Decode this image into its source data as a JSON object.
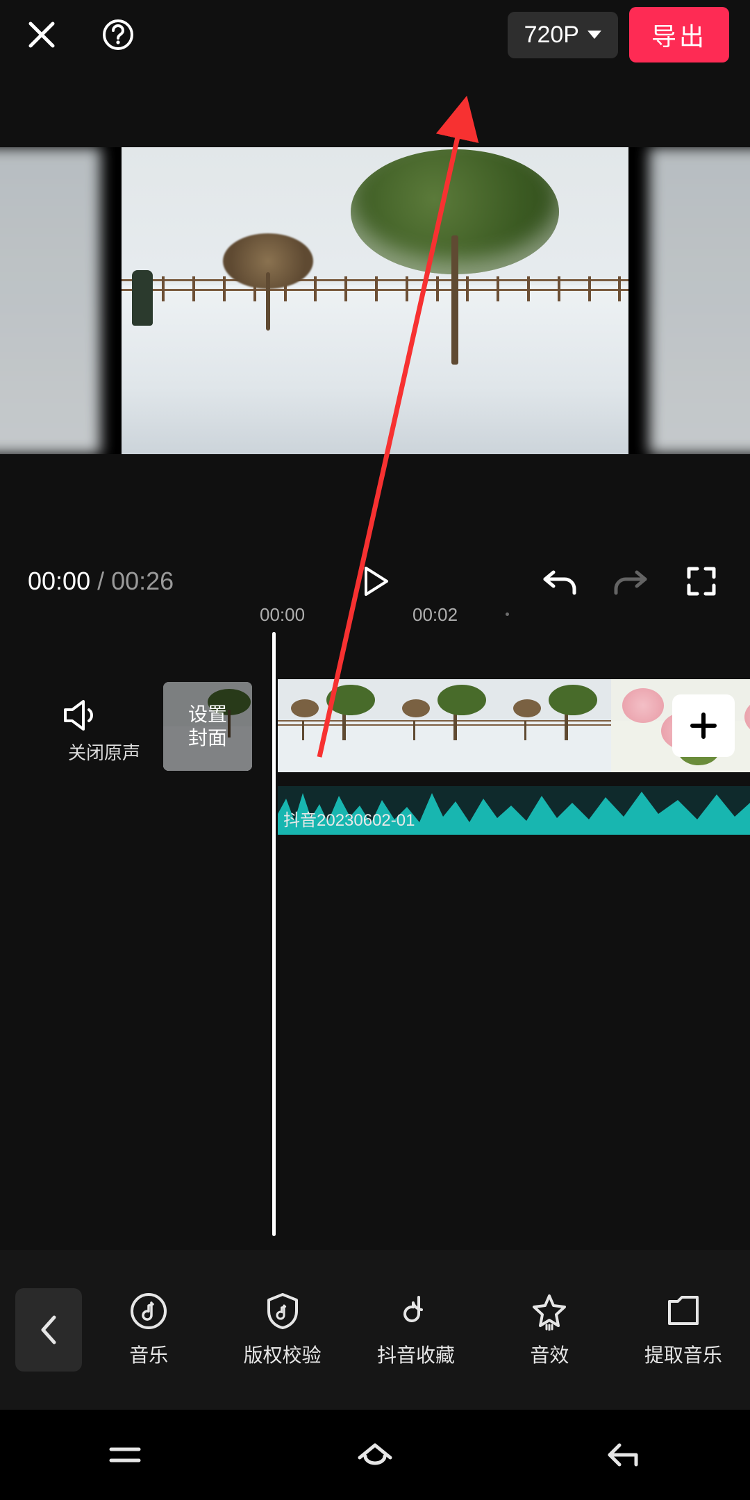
{
  "header": {
    "resolution_label": "720P",
    "export_label": "导出"
  },
  "playback": {
    "current_time": "00:00",
    "separator": "/",
    "total_time": "00:26"
  },
  "ruler": {
    "mark_0": "00:00",
    "mark_2": "00:02"
  },
  "timeline": {
    "mute_label": "关闭原声",
    "cover_label": "设置\n封面",
    "audio_name": "抖音20230602-01"
  },
  "toolbar": {
    "items": [
      {
        "label": "音乐",
        "icon": "music-icon"
      },
      {
        "label": "版权校验",
        "icon": "copyright-icon"
      },
      {
        "label": "抖音收藏",
        "icon": "douyin-fav-icon"
      },
      {
        "label": "音效",
        "icon": "sound-fx-icon"
      },
      {
        "label": "提取音乐",
        "icon": "extract-music-icon"
      }
    ]
  },
  "annotation": {
    "arrow_color": "#f73131"
  }
}
